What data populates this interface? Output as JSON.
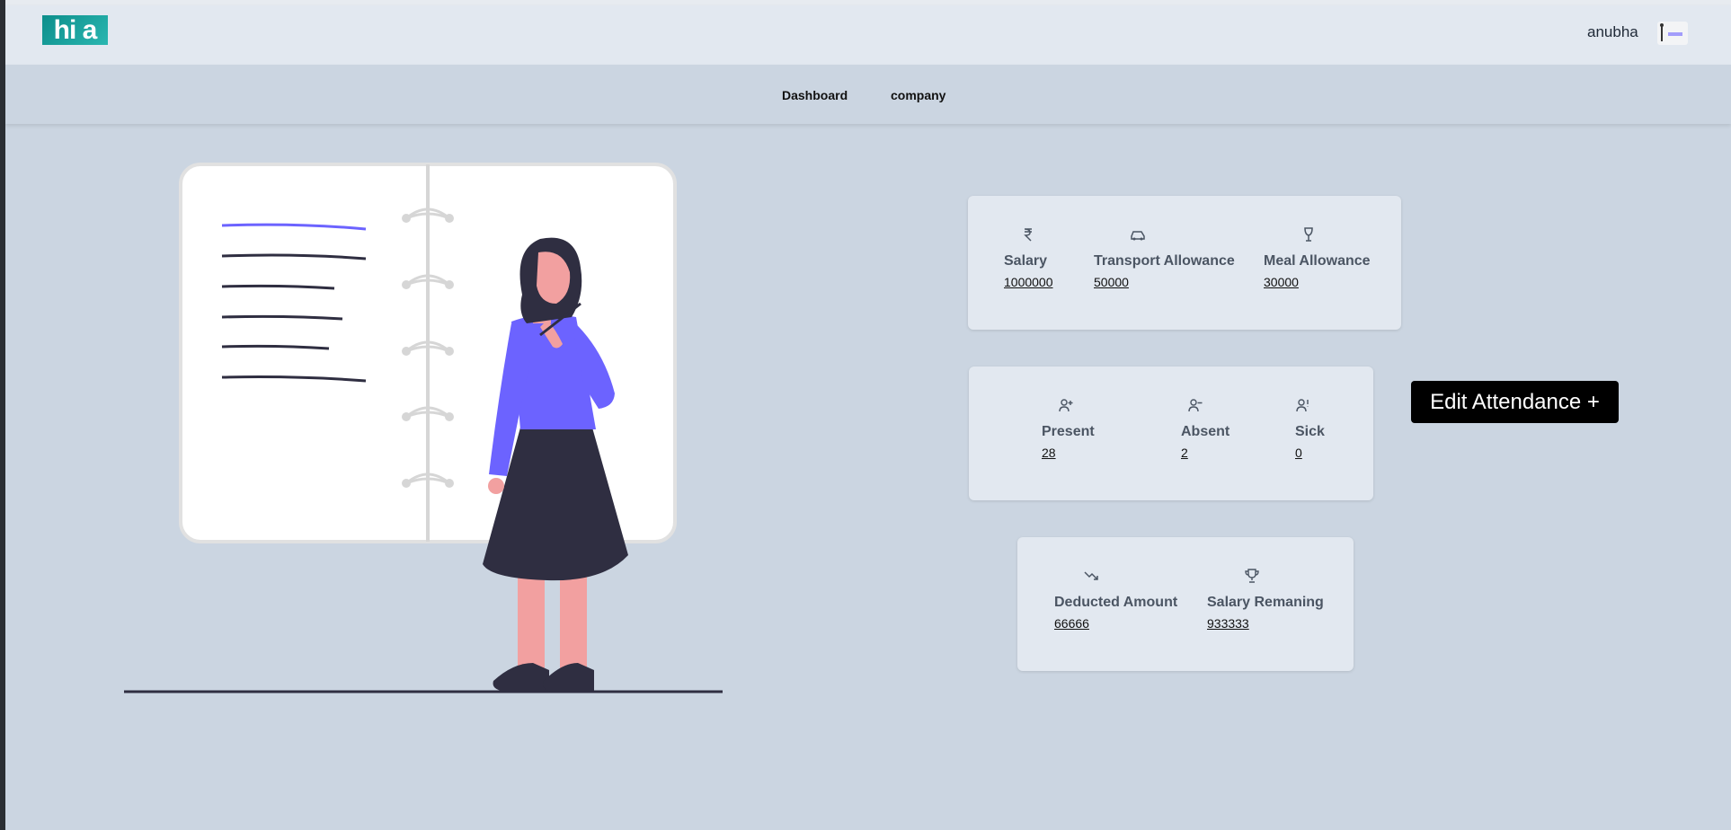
{
  "header": {
    "logo_text": "hi a",
    "username": "anubha"
  },
  "nav": {
    "items": [
      {
        "label": "Dashboard"
      },
      {
        "label": "company"
      }
    ]
  },
  "salary_card": {
    "salary": {
      "label": "Salary",
      "value": "1000000",
      "icon": "rupee-icon"
    },
    "transport": {
      "label": "Transport Allowance",
      "value": "50000",
      "icon": "car-icon"
    },
    "meal": {
      "label": "Meal Allowance",
      "value": "30000",
      "icon": "glass-icon"
    }
  },
  "attendance_card": {
    "present": {
      "label": "Present",
      "value": "28",
      "icon": "user-plus-icon"
    },
    "absent": {
      "label": "Absent",
      "value": "2",
      "icon": "user-minus-icon"
    },
    "sick": {
      "label": "Sick",
      "value": "0",
      "icon": "user-alert-icon"
    }
  },
  "edit_attendance": {
    "label": "Edit Attendance +"
  },
  "deduction_card": {
    "deducted": {
      "label": "Deducted Amount",
      "value": "66666",
      "icon": "trending-down-icon"
    },
    "remaining": {
      "label": "Salary Remaning",
      "value": "933333",
      "icon": "trophy-icon"
    }
  },
  "colors": {
    "page_bg": "#cbd5e1",
    "header_bg": "#e2e8f0",
    "card_bg": "#e2e8f0",
    "accent": "#6c63ff",
    "button_bg": "#000000"
  }
}
